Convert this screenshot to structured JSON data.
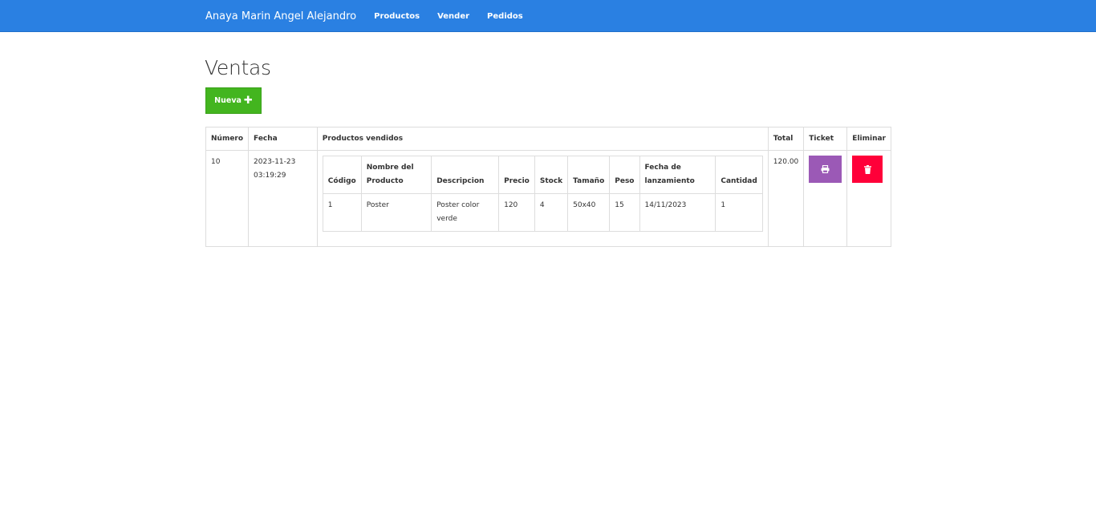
{
  "navbar": {
    "brand": "Anaya Marin Angel Alejandro",
    "links": [
      "Productos",
      "Vender",
      "Pedidos"
    ]
  },
  "page": {
    "title": "Ventas",
    "new_button": "Nueva"
  },
  "sales_table": {
    "headers": [
      "Número",
      "Fecha",
      "Productos vendidos",
      "Total",
      "Ticket",
      "Eliminar"
    ],
    "rows": [
      {
        "numero": "10",
        "fecha_date": "2023-11-23",
        "fecha_time": "03:19:29",
        "total": "120.00",
        "products": {
          "headers": [
            "Código",
            "Nombre del Producto",
            "Descripcion",
            "Precio",
            "Stock",
            "Tamaño",
            "Peso",
            "Fecha de lanzamiento",
            "Cantidad"
          ],
          "rows": [
            [
              "1",
              "Poster",
              "Poster color verde",
              "120",
              "4",
              "50x40",
              "15",
              "14/11/2023",
              "1"
            ]
          ]
        }
      }
    ]
  },
  "colors": {
    "navbar": "#2a80e2",
    "new_button": "#43b51f",
    "ticket_button": "#9b59b6",
    "delete_button": "#ff0039"
  },
  "icons": {
    "new": "plus-icon",
    "ticket": "print-icon",
    "delete": "trash-icon"
  }
}
